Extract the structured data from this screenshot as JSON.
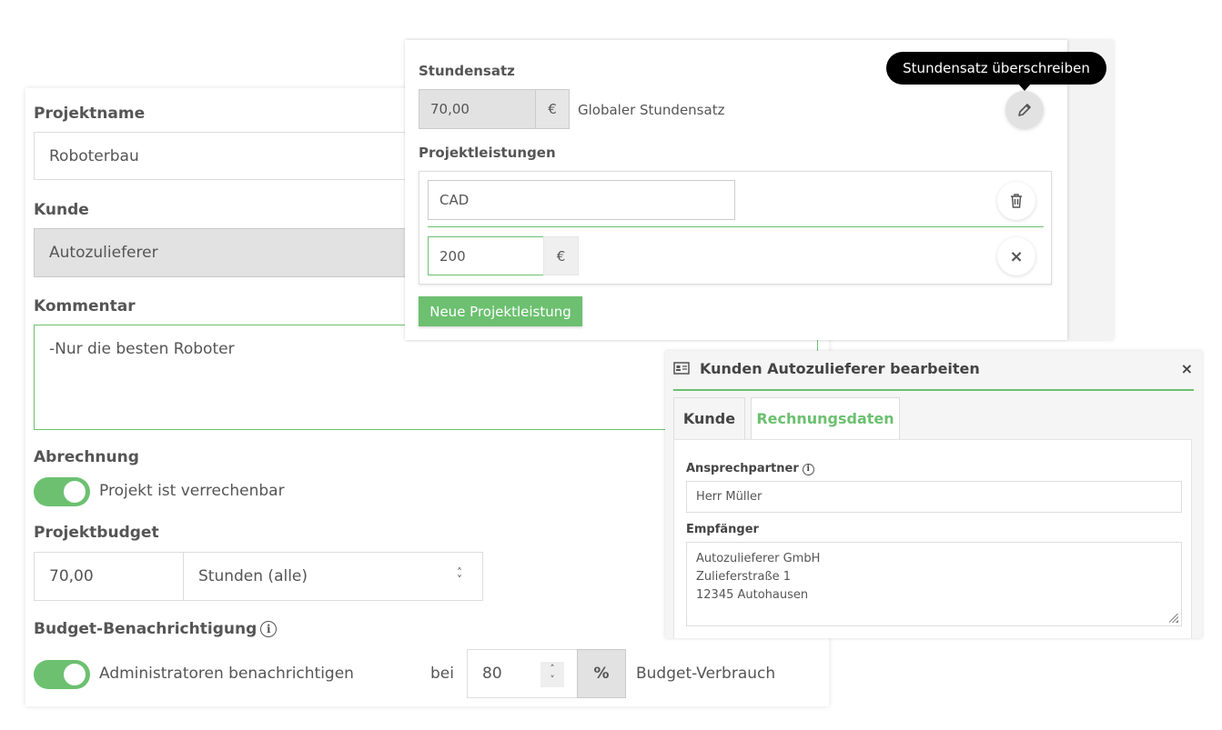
{
  "project": {
    "name_label": "Projektname",
    "name_value": "Roboterbau",
    "customer_label": "Kunde",
    "customer_value": "Autozulieferer",
    "comment_label": "Kommentar",
    "comment_value": "-Nur die besten Roboter",
    "billing_label": "Abrechnung",
    "billing_toggle_label": "Projekt ist verrechenbar",
    "billing_toggle_on": true,
    "budget_label": "Projektbudget",
    "budget_value": "70,00",
    "budget_type": "Stunden (alle)",
    "notify_label": "Budget-Benachrichtigung",
    "notify_toggle_label": "Administratoren benachrichtigen",
    "notify_toggle_on": true,
    "notify_at_label": "bei",
    "notify_percent_value": "80",
    "notify_percent_unit": "%",
    "notify_suffix": "Budget-Verbrauch"
  },
  "rate_panel": {
    "rate_label": "Stundensatz",
    "rate_value": "70,00",
    "currency": "€",
    "rate_hint": "Globaler Stundensatz",
    "override_tooltip": "Stundensatz überschreiben",
    "services_label": "Projektleistungen",
    "services": [
      {
        "name": "CAD",
        "price": "200",
        "currency": "€"
      }
    ],
    "new_service_button": "Neue Projektleistung"
  },
  "customer_dialog": {
    "title": "Kunden Autozulieferer bearbeiten",
    "close": "×",
    "tabs": [
      {
        "label": "Kunde",
        "active": false
      },
      {
        "label": "Rechnungsdaten",
        "active": true
      }
    ],
    "contact_label": "Ansprechpartner",
    "contact_value": "Herr Müller",
    "recipient_label": "Empfänger",
    "recipient_lines": [
      "Autozulieferer GmbH",
      "Zulieferstraße 1",
      "12345 Autohausen"
    ]
  },
  "colors": {
    "accent_green": "#6cc070",
    "tooltip_bg": "#000000"
  }
}
